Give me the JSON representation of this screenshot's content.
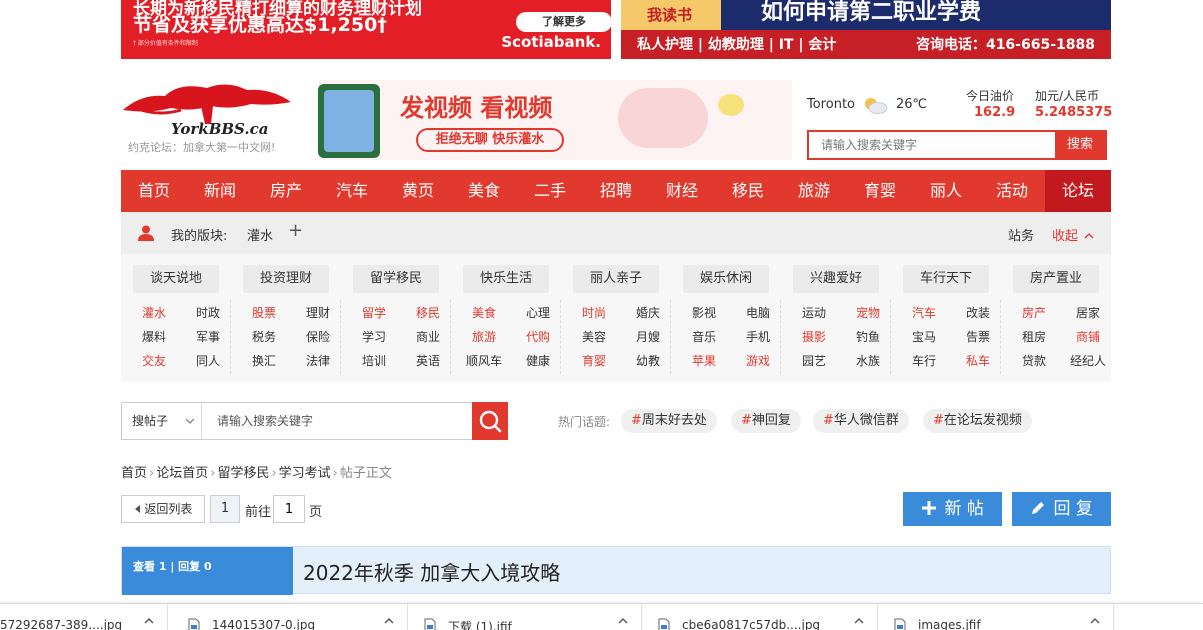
{
  "ads": {
    "left": {
      "line1": "长期为新移民精打细算的财务理财计划",
      "line2": "节省及获享优惠高达$1,250†",
      "fine_print": "† 部分价值有条件和限制",
      "cta": "了解更多",
      "brand": "Scotiabank."
    },
    "right": {
      "badge": "我读书",
      "headline": "如何申请第二职业学费",
      "courses": "私人护理 | 幼教助理 | IT | 会计",
      "phone": "咨询电话：416-665-1888"
    }
  },
  "logo": {
    "text": "YorkBBS.ca",
    "tagline": "约克论坛：加拿大第一中文网!"
  },
  "mid_ad": {
    "headline": "发视频 看视频",
    "pill": "拒绝无聊 快乐灌水"
  },
  "weather": {
    "city": "Toronto",
    "temp": "26℃",
    "icon": "cloud-sun-icon"
  },
  "quotes": [
    {
      "label": "今日油价",
      "value": "162.9"
    },
    {
      "label": "加元/人民币",
      "value": "5.2485375"
    }
  ],
  "top_search": {
    "placeholder": "请输入搜索关键字",
    "button": "搜索"
  },
  "nav": [
    "首页",
    "新闻",
    "房产",
    "汽车",
    "黄页",
    "美食",
    "二手",
    "招聘",
    "财经",
    "移民",
    "旅游",
    "育婴",
    "丽人",
    "活动",
    "论坛"
  ],
  "boards_bar": {
    "label": "我的版块:",
    "board": "灌水",
    "plus": "+",
    "site": "站务",
    "collapse": "收起"
  },
  "categories": [
    {
      "head": "谈天说地",
      "subs": [
        [
          "灌水",
          "red"
        ],
        [
          "时政",
          ""
        ],
        [
          "爆料",
          ""
        ],
        [
          "军事",
          ""
        ],
        [
          "交友",
          "red"
        ],
        [
          "同人",
          ""
        ]
      ]
    },
    {
      "head": "投资理财",
      "subs": [
        [
          "股票",
          "red"
        ],
        [
          "理财",
          ""
        ],
        [
          "税务",
          ""
        ],
        [
          "保险",
          ""
        ],
        [
          "换汇",
          ""
        ],
        [
          "法律",
          ""
        ]
      ]
    },
    {
      "head": "留学移民",
      "subs": [
        [
          "留学",
          "red"
        ],
        [
          "移民",
          "red"
        ],
        [
          "学习",
          ""
        ],
        [
          "商业",
          ""
        ],
        [
          "培训",
          ""
        ],
        [
          "英语",
          ""
        ]
      ]
    },
    {
      "head": "快乐生活",
      "subs": [
        [
          "美食",
          "red"
        ],
        [
          "心理",
          ""
        ],
        [
          "旅游",
          "red"
        ],
        [
          "代购",
          "red"
        ],
        [
          "顺风车",
          ""
        ],
        [
          "健康",
          ""
        ]
      ]
    },
    {
      "head": "丽人亲子",
      "subs": [
        [
          "时尚",
          "red"
        ],
        [
          "婚庆",
          ""
        ],
        [
          "美容",
          ""
        ],
        [
          "月嫂",
          ""
        ],
        [
          "育婴",
          "red"
        ],
        [
          "幼教",
          ""
        ]
      ]
    },
    {
      "head": "娱乐休闲",
      "subs": [
        [
          "影视",
          ""
        ],
        [
          "电脑",
          ""
        ],
        [
          "音乐",
          ""
        ],
        [
          "手机",
          ""
        ],
        [
          "苹果",
          "red"
        ],
        [
          "游戏",
          "red"
        ]
      ]
    },
    {
      "head": "兴趣爱好",
      "subs": [
        [
          "运动",
          ""
        ],
        [
          "宠物",
          "red"
        ],
        [
          "摄影",
          "red"
        ],
        [
          "钓鱼",
          ""
        ],
        [
          "园艺",
          ""
        ],
        [
          "水族",
          ""
        ]
      ]
    },
    {
      "head": "车行天下",
      "subs": [
        [
          "汽车",
          "red"
        ],
        [
          "改装",
          ""
        ],
        [
          "宝马",
          ""
        ],
        [
          "告票",
          ""
        ],
        [
          "车行",
          ""
        ],
        [
          "私车",
          "red"
        ]
      ]
    },
    {
      "head": "房产置业",
      "subs": [
        [
          "房产",
          "red"
        ],
        [
          "居家",
          ""
        ],
        [
          "租房",
          ""
        ],
        [
          "商铺",
          "red"
        ],
        [
          "贷款",
          ""
        ],
        [
          "经纪人",
          ""
        ]
      ]
    }
  ],
  "forum_search": {
    "scope": "搜帖子",
    "placeholder": "请输入搜索关键字"
  },
  "hot_topics": {
    "label": "热门话题:",
    "tags": [
      "周末好去处",
      "神回复",
      "华人微信群",
      "在论坛发视频"
    ]
  },
  "breadcrumb": [
    "首页",
    "论坛首页",
    "留学移民",
    "学习考试",
    "帖子正文"
  ],
  "pager": {
    "back": "返回列表",
    "current": "1",
    "goto_label": "前往",
    "goto_value": "1",
    "page_label": "页"
  },
  "actions": {
    "new_post": "新 帖",
    "reply": "回 复"
  },
  "post": {
    "stats": "查看 1 | 回复 0",
    "title": "2022年秋季 加拿大入境攻略"
  },
  "downloads": [
    "57292687-389....jpg",
    "144015307-0.jpg",
    "下载 (1).jfif",
    "cbe6a0817c57db....jpg",
    "images.jfif"
  ],
  "colors": {
    "brand_red": "#e2392f",
    "nav_active": "#c1191e",
    "action_blue": "#3b8bdb"
  }
}
